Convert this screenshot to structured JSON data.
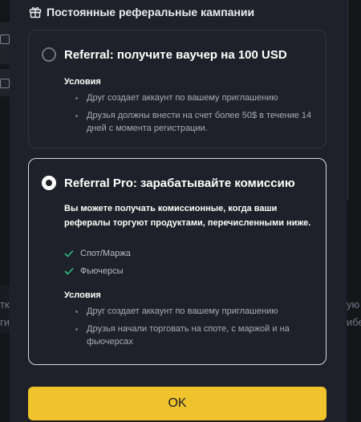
{
  "modal": {
    "header": "Постоянные реферальные кампании",
    "ok_label": "OK"
  },
  "referral": {
    "title": "Referral: получите ваучер на 100 USD",
    "conditions_title": "Условия",
    "conditions": [
      "Друг создает аккаунт по вашему приглашению",
      "Друзья должны внести на счет более 50$ в течение 14 дней с момента регистрации."
    ]
  },
  "referral_pro": {
    "title": "Referral Pro: зарабатывайте комиссию",
    "description": "Вы можете получать комиссионные, когда ваши рефералы торгуют продуктами, перечисленными ниже.",
    "products": [
      "Спот/Маржа",
      "Фьючерсы"
    ],
    "conditions_title": "Условия",
    "conditions": [
      "Друг создает аккаунт по вашему приглашению",
      "Друзья начали торговать на споте, с маржой и на фьючерсах"
    ]
  },
  "background": {
    "left_fragment_1": "тк",
    "left_fragment_2": "ги",
    "right_fragment_1": "ую",
    "right_fragment_2": "ибе"
  },
  "colors": {
    "accent": "#f0c22b",
    "check": "#2ebd85",
    "modal_bg": "#1e2129"
  },
  "icons": {
    "header": "gift-icon",
    "check": "check-icon",
    "copy": "copy-icon"
  }
}
